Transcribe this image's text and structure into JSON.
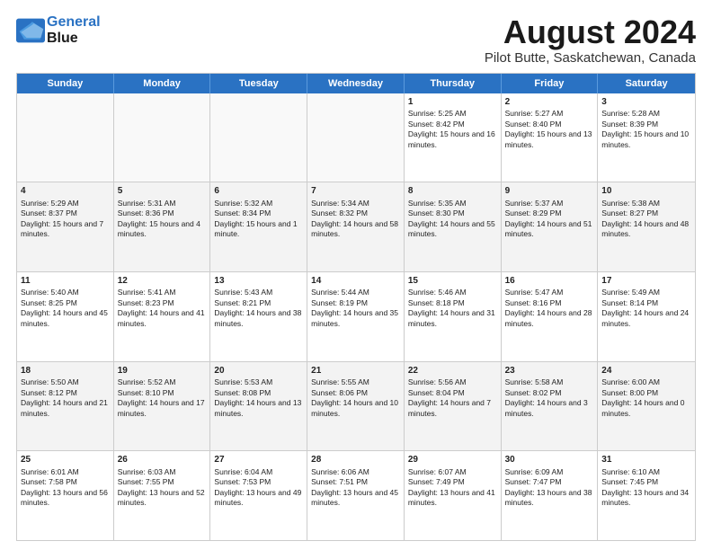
{
  "header": {
    "logo_line1": "General",
    "logo_line2": "Blue",
    "title": "August 2024",
    "subtitle": "Pilot Butte, Saskatchewan, Canada"
  },
  "weekdays": [
    "Sunday",
    "Monday",
    "Tuesday",
    "Wednesday",
    "Thursday",
    "Friday",
    "Saturday"
  ],
  "rows": [
    [
      {
        "day": "",
        "info": ""
      },
      {
        "day": "",
        "info": ""
      },
      {
        "day": "",
        "info": ""
      },
      {
        "day": "",
        "info": ""
      },
      {
        "day": "1",
        "info": "Sunrise: 5:25 AM\nSunset: 8:42 PM\nDaylight: 15 hours and 16 minutes."
      },
      {
        "day": "2",
        "info": "Sunrise: 5:27 AM\nSunset: 8:40 PM\nDaylight: 15 hours and 13 minutes."
      },
      {
        "day": "3",
        "info": "Sunrise: 5:28 AM\nSunset: 8:39 PM\nDaylight: 15 hours and 10 minutes."
      }
    ],
    [
      {
        "day": "4",
        "info": "Sunrise: 5:29 AM\nSunset: 8:37 PM\nDaylight: 15 hours and 7 minutes."
      },
      {
        "day": "5",
        "info": "Sunrise: 5:31 AM\nSunset: 8:36 PM\nDaylight: 15 hours and 4 minutes."
      },
      {
        "day": "6",
        "info": "Sunrise: 5:32 AM\nSunset: 8:34 PM\nDaylight: 15 hours and 1 minute."
      },
      {
        "day": "7",
        "info": "Sunrise: 5:34 AM\nSunset: 8:32 PM\nDaylight: 14 hours and 58 minutes."
      },
      {
        "day": "8",
        "info": "Sunrise: 5:35 AM\nSunset: 8:30 PM\nDaylight: 14 hours and 55 minutes."
      },
      {
        "day": "9",
        "info": "Sunrise: 5:37 AM\nSunset: 8:29 PM\nDaylight: 14 hours and 51 minutes."
      },
      {
        "day": "10",
        "info": "Sunrise: 5:38 AM\nSunset: 8:27 PM\nDaylight: 14 hours and 48 minutes."
      }
    ],
    [
      {
        "day": "11",
        "info": "Sunrise: 5:40 AM\nSunset: 8:25 PM\nDaylight: 14 hours and 45 minutes."
      },
      {
        "day": "12",
        "info": "Sunrise: 5:41 AM\nSunset: 8:23 PM\nDaylight: 14 hours and 41 minutes."
      },
      {
        "day": "13",
        "info": "Sunrise: 5:43 AM\nSunset: 8:21 PM\nDaylight: 14 hours and 38 minutes."
      },
      {
        "day": "14",
        "info": "Sunrise: 5:44 AM\nSunset: 8:19 PM\nDaylight: 14 hours and 35 minutes."
      },
      {
        "day": "15",
        "info": "Sunrise: 5:46 AM\nSunset: 8:18 PM\nDaylight: 14 hours and 31 minutes."
      },
      {
        "day": "16",
        "info": "Sunrise: 5:47 AM\nSunset: 8:16 PM\nDaylight: 14 hours and 28 minutes."
      },
      {
        "day": "17",
        "info": "Sunrise: 5:49 AM\nSunset: 8:14 PM\nDaylight: 14 hours and 24 minutes."
      }
    ],
    [
      {
        "day": "18",
        "info": "Sunrise: 5:50 AM\nSunset: 8:12 PM\nDaylight: 14 hours and 21 minutes."
      },
      {
        "day": "19",
        "info": "Sunrise: 5:52 AM\nSunset: 8:10 PM\nDaylight: 14 hours and 17 minutes."
      },
      {
        "day": "20",
        "info": "Sunrise: 5:53 AM\nSunset: 8:08 PM\nDaylight: 14 hours and 13 minutes."
      },
      {
        "day": "21",
        "info": "Sunrise: 5:55 AM\nSunset: 8:06 PM\nDaylight: 14 hours and 10 minutes."
      },
      {
        "day": "22",
        "info": "Sunrise: 5:56 AM\nSunset: 8:04 PM\nDaylight: 14 hours and 7 minutes."
      },
      {
        "day": "23",
        "info": "Sunrise: 5:58 AM\nSunset: 8:02 PM\nDaylight: 14 hours and 3 minutes."
      },
      {
        "day": "24",
        "info": "Sunrise: 6:00 AM\nSunset: 8:00 PM\nDaylight: 14 hours and 0 minutes."
      }
    ],
    [
      {
        "day": "25",
        "info": "Sunrise: 6:01 AM\nSunset: 7:58 PM\nDaylight: 13 hours and 56 minutes."
      },
      {
        "day": "26",
        "info": "Sunrise: 6:03 AM\nSunset: 7:55 PM\nDaylight: 13 hours and 52 minutes."
      },
      {
        "day": "27",
        "info": "Sunrise: 6:04 AM\nSunset: 7:53 PM\nDaylight: 13 hours and 49 minutes."
      },
      {
        "day": "28",
        "info": "Sunrise: 6:06 AM\nSunset: 7:51 PM\nDaylight: 13 hours and 45 minutes."
      },
      {
        "day": "29",
        "info": "Sunrise: 6:07 AM\nSunset: 7:49 PM\nDaylight: 13 hours and 41 minutes."
      },
      {
        "day": "30",
        "info": "Sunrise: 6:09 AM\nSunset: 7:47 PM\nDaylight: 13 hours and 38 minutes."
      },
      {
        "day": "31",
        "info": "Sunrise: 6:10 AM\nSunset: 7:45 PM\nDaylight: 13 hours and 34 minutes."
      }
    ]
  ]
}
